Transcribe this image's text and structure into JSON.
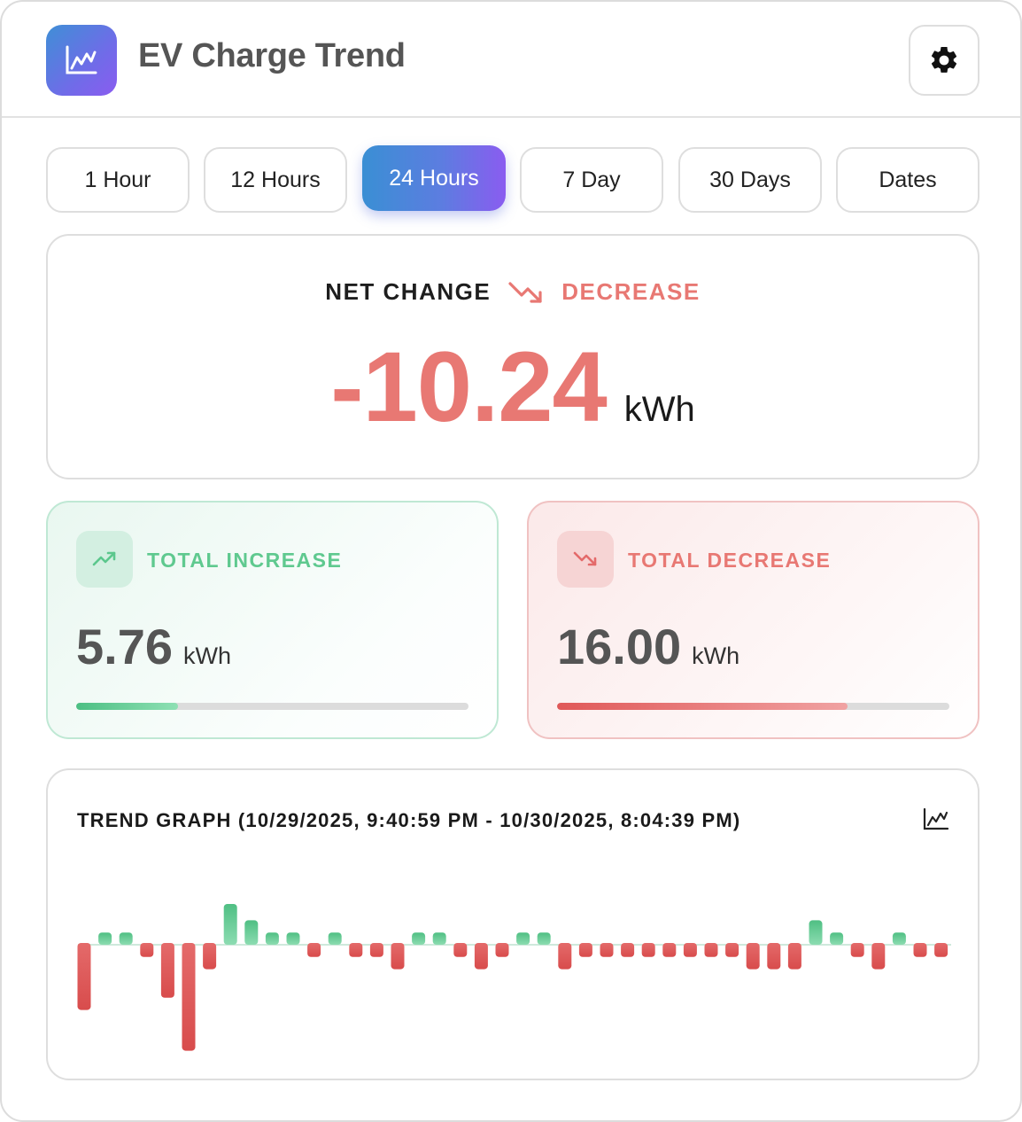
{
  "header": {
    "title": "EV Charge Trend",
    "app_icon": "line-chart-icon",
    "settings_icon": "gear-icon"
  },
  "tabs": [
    {
      "label": "1 Hour",
      "active": false
    },
    {
      "label": "12 Hours",
      "active": false
    },
    {
      "label": "24 Hours",
      "active": true
    },
    {
      "label": "7 Day",
      "active": false
    },
    {
      "label": "30 Days",
      "active": false
    },
    {
      "label": "Dates",
      "active": false
    }
  ],
  "net_change": {
    "label": "NET CHANGE",
    "status": "DECREASE",
    "value": "-10.24",
    "unit": "kWh",
    "icon": "trending-down-icon"
  },
  "total_increase": {
    "label": "TOTAL INCREASE",
    "value": "5.76",
    "unit": "kWh",
    "bar_fraction": 0.26,
    "icon": "trending-up-icon"
  },
  "total_decrease": {
    "label": "TOTAL DECREASE",
    "value": "16.00",
    "unit": "kWh",
    "bar_fraction": 0.74,
    "icon": "trending-down-icon"
  },
  "graph": {
    "title": "TREND GRAPH",
    "range": "(10/29/2025, 9:40:59 PM - 10/30/2025, 8:04:39 PM)",
    "icon": "line-chart-icon"
  },
  "colors": {
    "increase": "#5cc78d",
    "decrease": "#e46a6a",
    "accent_start": "#3a8fd4",
    "accent_end": "#8a5cf0"
  },
  "chart_data": {
    "type": "bar",
    "series": [
      {
        "values": [
          -1.6,
          0.3,
          0.3,
          -0.3,
          -1.3,
          -2.6,
          -0.6,
          1.0,
          0.6,
          0.3,
          0.3,
          -0.3,
          0.3,
          -0.3,
          -0.3,
          -0.6,
          0.3,
          0.3,
          -0.3,
          -0.6,
          -0.3,
          0.3,
          0.3,
          -0.6,
          -0.3,
          -0.3,
          -0.3,
          -0.3,
          -0.3,
          -0.3,
          -0.3,
          -0.3,
          -0.6,
          -0.6,
          -0.6,
          0.6,
          0.3,
          -0.3,
          -0.6,
          0.3,
          -0.3,
          -0.3
        ]
      }
    ],
    "title": "",
    "xlabel": "",
    "ylabel": ""
  }
}
